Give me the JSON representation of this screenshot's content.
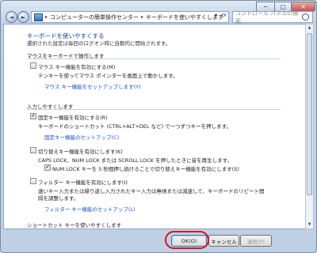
{
  "titlebar": {
    "min": "─",
    "max": "□",
    "close": "✕"
  },
  "nav": {
    "back": "◄",
    "forward": "►",
    "breadcrumb": [
      "コンピューターの簡単操作センター",
      "キーボードを使いやすくします"
    ],
    "separator": "▸",
    "dropdown": "▾",
    "refresh": "⟳",
    "search_placeholder": "コントロール パネルの検索"
  },
  "page": {
    "title": "キーボードを使いやすくする",
    "subtitle": "選択された設定は毎回のログオン時に自動的に開始されます。"
  },
  "sections": {
    "mouse": {
      "heading": "マウスをキーボードで操作します",
      "mousekeys_label": "マウス キー機能を有効にする(M)",
      "mousekeys_checked": false,
      "mousekeys_desc": "テンキーを使ってマウス ポインターを画面上で動かします。",
      "mousekeys_link": "マウス キー機能をセットアップします(Y)"
    },
    "typing": {
      "heading": "入力しやすくします",
      "sticky_label": "固定キー機能を有効にする(R)",
      "sticky_checked": true,
      "sticky_desc": "キーボードのショートカット (CTRL+ALT+DEL など) で一つずつキーを押します。",
      "sticky_link": "固定キー機能のセットアップ(C)",
      "toggle_label": "切り替えキー機能を有効にします(K)",
      "toggle_checked": false,
      "toggle_desc": "CAPS LOCK、NUM LOCK または SCROLL LOCK を押したときに音を再生します。",
      "numlock_label": "NUM LOCK キーを 5 秒間押し続けることで切り替えキー機能を有効にします(S)",
      "numlock_checked": true,
      "filter_label": "フィルター キー機能を有効にします(I)",
      "filter_checked": false,
      "filter_desc1": "速いキー入力または繰り返し入力されたキー入力は無視または減速して、キーボードのリピート間",
      "filter_desc2": "隔を調整します。",
      "filter_link": "フィルター キー機能のセットアップ(L)"
    },
    "shortcut": {
      "heading": "ショートカット キーを使いやすくします"
    }
  },
  "buttons": {
    "ok": "OK(O)",
    "cancel": "キャンセル",
    "apply": "適用(P)"
  },
  "scrollbar": {
    "up": "▲",
    "down": "▼"
  },
  "check_mark": "✔"
}
